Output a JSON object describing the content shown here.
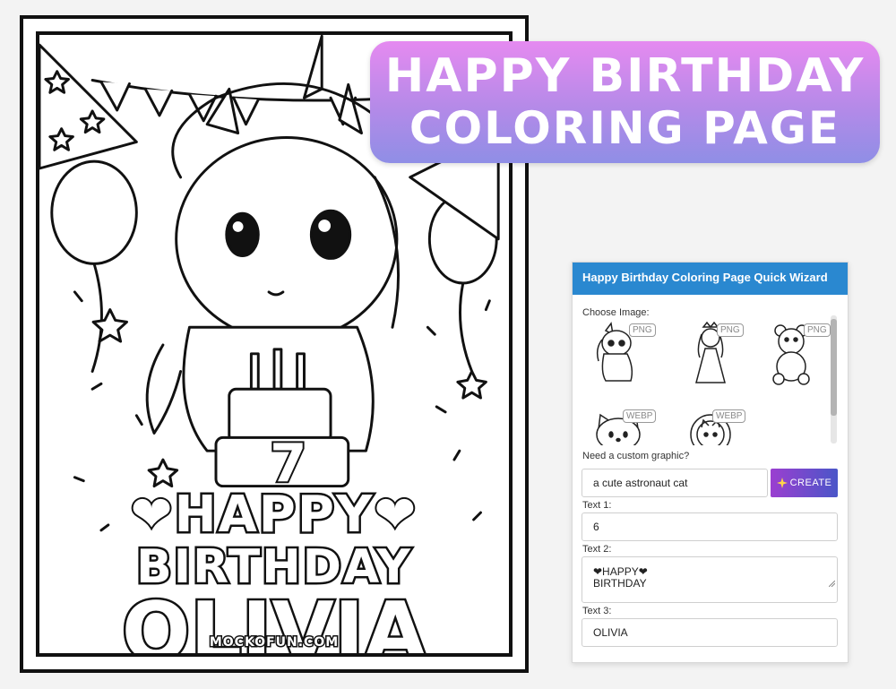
{
  "banner": {
    "line1": "HAPPY BIRTHDAY",
    "line2": "COLORING PAGE"
  },
  "coloring_page": {
    "cake_number": "7",
    "line1_heart": "❤",
    "line1_text": "HAPPY",
    "line2": "BIRTHDAY",
    "name": "OLIVIA",
    "watermark": "MOCKOFUN.COM"
  },
  "wizard": {
    "title": "Happy Birthday Coloring Page Quick Wizard",
    "choose_image_label": "Choose Image:",
    "thumbnails": [
      {
        "badge": "PNG",
        "icon": "unicorn-icon"
      },
      {
        "badge": "PNG",
        "icon": "princess-icon"
      },
      {
        "badge": "PNG",
        "icon": "teddy-bear-icon"
      },
      {
        "badge": "WEBP",
        "icon": "kitty-icon"
      },
      {
        "badge": "WEBP",
        "icon": "astronaut-cat-icon"
      }
    ],
    "custom_label": "Need a custom graphic?",
    "prompt_value": "a cute astronaut cat",
    "create_icon": "sparkles-icon",
    "create_label": "CREATE",
    "text1_label": "Text 1:",
    "text1_value": "6",
    "text2_label": "Text 2:",
    "text2_value": "❤HAPPY❤\nBIRTHDAY",
    "text3_label": "Text 3:",
    "text3_value": "OLIVIA"
  },
  "colors": {
    "banner_top": "#e58af0",
    "banner_bottom": "#8f8ee6",
    "wizard_header": "#2a88d0",
    "create_left": "#9b3fd0",
    "create_right": "#4a56c8"
  }
}
